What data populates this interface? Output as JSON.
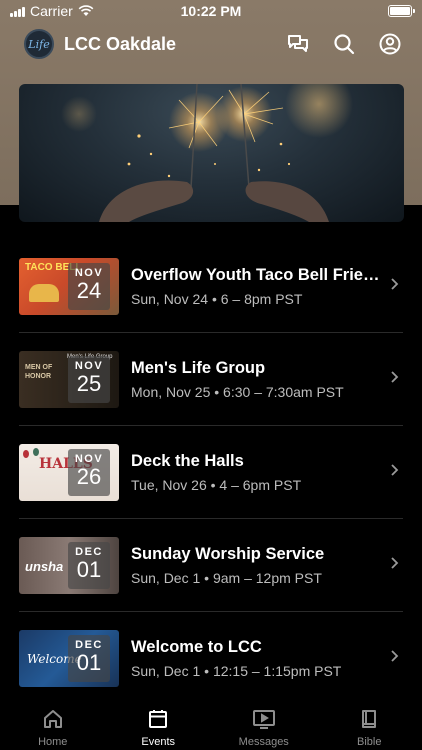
{
  "status_bar": {
    "carrier": "Carrier",
    "time": "10:22 PM"
  },
  "header": {
    "logo_text": "Life",
    "title": "LCC Oakdale",
    "icons": [
      "messages-icon",
      "search-icon",
      "account-icon"
    ]
  },
  "hero": {
    "image": "sparklers-photo"
  },
  "events": [
    {
      "title": "Overflow Youth Taco Bell Friends",
      "meta": "Sun, Nov 24 • 6 – 8pm PST",
      "month": "NOV",
      "day": "24"
    },
    {
      "title": "Men's Life Group",
      "meta": "Mon, Nov 25 • 6:30 – 7:30am PST",
      "month": "NOV",
      "day": "25"
    },
    {
      "title": "Deck the Halls",
      "meta": "Tue, Nov 26 • 4 – 6pm PST",
      "month": "NOV",
      "day": "26"
    },
    {
      "title": "Sunday Worship Service",
      "meta": "Sun, Dec 1 • 9am – 12pm PST",
      "month": "DEC",
      "day": "01"
    },
    {
      "title": "Welcome to LCC",
      "meta": "Sun, Dec 1 • 12:15 – 1:15pm PST",
      "month": "DEC",
      "day": "01"
    }
  ],
  "tabs": [
    {
      "label": "Home",
      "icon": "home-icon",
      "active": false
    },
    {
      "label": "Events",
      "icon": "calendar-icon",
      "active": true
    },
    {
      "label": "Messages",
      "icon": "video-icon",
      "active": false
    },
    {
      "label": "Bible",
      "icon": "book-icon",
      "active": false
    }
  ],
  "colors": {
    "header_bg": "#8a7a68",
    "background": "#000000",
    "muted_text": "#bdbdbd",
    "tab_inactive": "#8e8e8e"
  }
}
